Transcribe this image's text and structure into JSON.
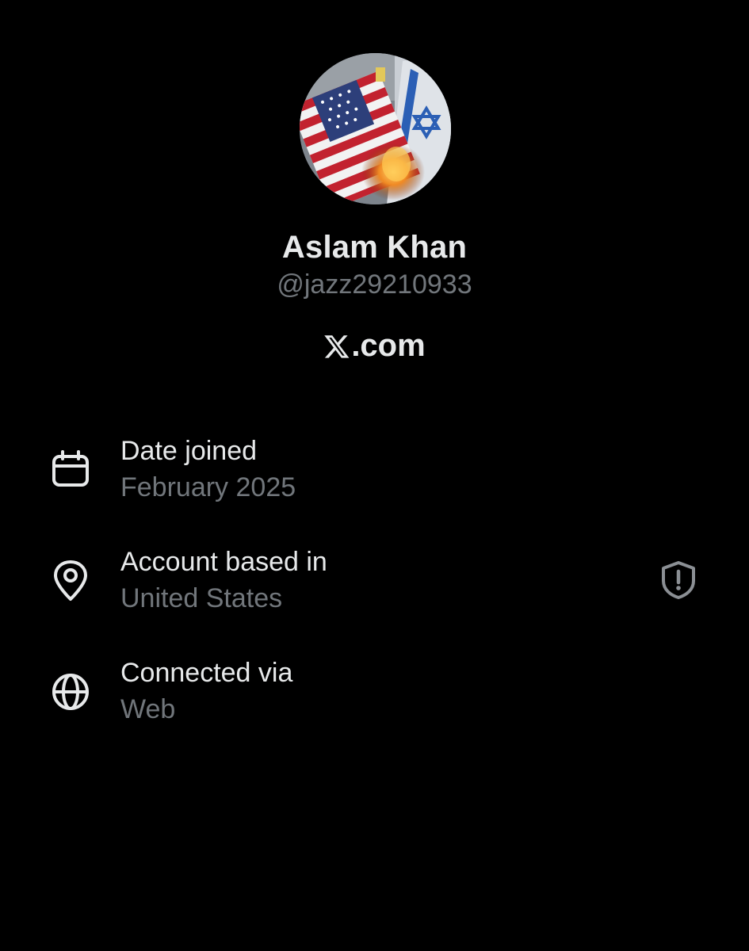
{
  "profile": {
    "display_name": "Aslam Khan",
    "handle": "@jazz29210933",
    "avatar_icon": "profile-photo"
  },
  "site": {
    "logo_icon": "x-logo-icon",
    "label": ".com"
  },
  "details": [
    {
      "icon": "calendar-icon",
      "label": "Date joined",
      "value": "February 2025"
    },
    {
      "icon": "location-pin-icon",
      "label": "Account based in",
      "value": "United States",
      "badge_icon": "shield-alert-icon"
    },
    {
      "icon": "globe-icon",
      "label": "Connected via",
      "value": "Web"
    }
  ],
  "colors": {
    "background": "#000000",
    "primary_text": "#e7e9ea",
    "secondary_text": "#71767b"
  }
}
